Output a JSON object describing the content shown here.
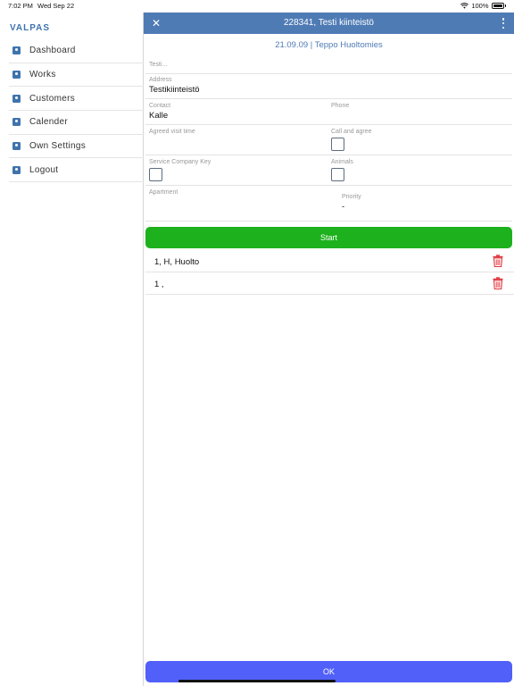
{
  "status_bar": {
    "time": "7:02 PM",
    "date": "Wed Sep 22",
    "battery": "100%",
    "icons": [
      "wifi-icon",
      "battery-icon"
    ]
  },
  "sidebar": {
    "brand": "VALPAS",
    "items": [
      {
        "label": "Dashboard",
        "icon": "person-badge-icon"
      },
      {
        "label": "Works",
        "icon": "person-badge-icon"
      },
      {
        "label": "Customers",
        "icon": "person-badge-icon"
      },
      {
        "label": "Calender",
        "icon": "person-badge-icon"
      },
      {
        "label": "Own Settings",
        "icon": "chat-icon"
      },
      {
        "label": "Logout",
        "icon": "person-badge-icon"
      }
    ]
  },
  "header": {
    "title": "228341, Testi kiinteistö",
    "subtitle": "21.09.09 | Teppo Huoltomies"
  },
  "form": {
    "name_placeholder": "Testi...",
    "address_label": "Address",
    "address_value": "Testikiinteistö",
    "contact_label": "Contact",
    "contact_value": "Kalle",
    "phone_label": "Phone",
    "phone_value": "",
    "agreed_visit_label": "Agreed visit time",
    "agreed_visit_value": "",
    "call_agree_label": "Call and agree",
    "service_key_label": "Service Company Key",
    "animals_label": "Animals",
    "apartment_label": "Apartment",
    "apartment_value": "",
    "priority_label": "Priority",
    "priority_value": "-"
  },
  "buttons": {
    "start": "Start",
    "ok": "OK"
  },
  "tasks": [
    {
      "text": "1, H, Huolto"
    },
    {
      "text": "1 ,"
    }
  ],
  "colors": {
    "header": "#4f7bb5",
    "brand": "#3f74ad",
    "start": "#1db11d",
    "ok": "#5060f8",
    "trash": "#e0333a"
  }
}
